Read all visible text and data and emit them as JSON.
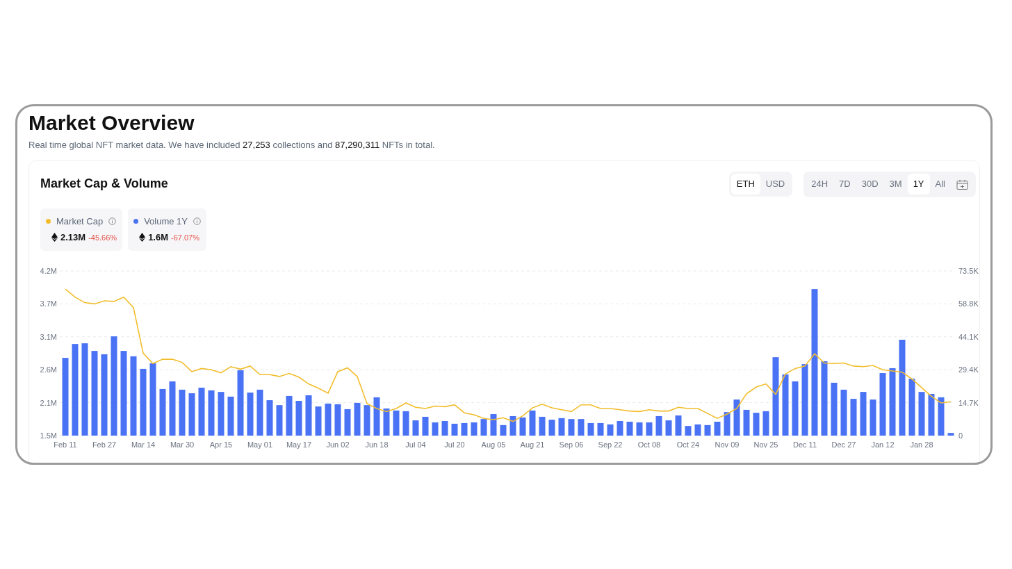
{
  "title": "Market Overview",
  "subtitle": [
    {
      "text": "Real time global NFT market data. We have included ",
      "highlight": false
    },
    {
      "text": "27,253",
      "highlight": true
    },
    {
      "text": " collections and ",
      "highlight": false
    },
    {
      "text": "87,290,311",
      "highlight": true
    },
    {
      "text": " NFTs in total.",
      "highlight": false
    }
  ],
  "card": {
    "title": "Market Cap & Volume",
    "currency_toggle": [
      {
        "label": "ETH",
        "selected": true
      },
      {
        "label": "USD",
        "selected": false
      }
    ],
    "range_toggle": [
      {
        "label": "24H",
        "selected": false
      },
      {
        "label": "7D",
        "selected": false
      },
      {
        "label": "30D",
        "selected": false
      },
      {
        "label": "3M",
        "selected": false
      },
      {
        "label": "1Y",
        "selected": true
      },
      {
        "label": "All",
        "selected": false
      }
    ],
    "legend": [
      {
        "value": "2.13M",
        "change": "-45.66%"
      },
      {
        "value": "1.6M",
        "change": "-67.07%"
      }
    ],
    "chart_data": {
      "type": "bar",
      "categories": [
        "Feb 11",
        null,
        null,
        null,
        "Feb 27",
        null,
        null,
        null,
        "Mar 14",
        null,
        null,
        null,
        "Mar 30",
        null,
        null,
        null,
        "Apr 15",
        null,
        null,
        null,
        "May 01",
        null,
        null,
        null,
        "May 17",
        null,
        null,
        null,
        "Jun 02",
        null,
        null,
        null,
        "Jun 18",
        null,
        null,
        null,
        "Jul 04",
        null,
        null,
        null,
        "Jul 20",
        null,
        null,
        null,
        "Aug 05",
        null,
        null,
        null,
        "Aug 21",
        null,
        null,
        null,
        "Sep 06",
        null,
        null,
        null,
        "Sep 22",
        null,
        null,
        null,
        "Oct 08",
        null,
        null,
        null,
        "Oct 24",
        null,
        null,
        null,
        "Nov 09",
        null,
        null,
        null,
        "Nov 25",
        null,
        null,
        null,
        "Dec 11",
        null,
        null,
        null,
        "Dec 27",
        null,
        null,
        null,
        "Jan 12",
        null,
        null,
        null,
        "Jan 28",
        null,
        null,
        null
      ],
      "grid": true,
      "ylim": [
        1.54,
        4.215
      ],
      "yticks": [
        {
          "value": 1.54,
          "label": "1.5M"
        },
        {
          "value": 2.075,
          "label": "2.1M"
        },
        {
          "value": 2.61,
          "label": "2.6M"
        },
        {
          "value": 3.145,
          "label": "3.1M"
        },
        {
          "value": 3.68,
          "label": "3.7M"
        },
        {
          "value": 4.215,
          "label": "4.2M"
        }
      ],
      "y2lim": [
        0,
        73.5
      ],
      "y2ticks": [
        {
          "value": 0,
          "label": "0"
        },
        {
          "value": 14.7,
          "label": "14.7K"
        },
        {
          "value": 29.4,
          "label": "29.4K"
        },
        {
          "value": 44.1,
          "label": "44.1K"
        },
        {
          "value": 58.8,
          "label": "58.8K"
        },
        {
          "value": 73.5,
          "label": "73.5K"
        }
      ],
      "series": [
        {
          "name": "Market Cap",
          "type": "line",
          "color": "#f2bd2c",
          "values": [
            3.92,
            3.79,
            3.7,
            3.68,
            3.73,
            3.72,
            3.79,
            3.62,
            2.88,
            2.71,
            2.78,
            2.78,
            2.73,
            2.58,
            2.63,
            2.61,
            2.56,
            2.66,
            2.62,
            2.67,
            2.53,
            2.53,
            2.5,
            2.55,
            2.49,
            2.38,
            2.31,
            2.23,
            2.58,
            2.64,
            2.5,
            2.06,
            1.98,
            1.93,
            1.98,
            2.07,
            2.0,
            1.98,
            2.02,
            2.01,
            2.04,
            1.91,
            1.88,
            1.82,
            1.8,
            1.83,
            1.77,
            1.86,
            1.99,
            2.05,
            1.99,
            1.96,
            1.93,
            2.04,
            2.04,
            1.98,
            1.98,
            1.96,
            1.94,
            1.93,
            1.96,
            1.94,
            1.94,
            2.0,
            1.98,
            1.98,
            1.9,
            1.82,
            1.89,
            1.98,
            2.22,
            2.33,
            2.38,
            2.21,
            2.54,
            2.63,
            2.67,
            2.87,
            2.72,
            2.71,
            2.72,
            2.67,
            2.66,
            2.68,
            2.61,
            2.59,
            2.57,
            2.46,
            2.32,
            2.18,
            2.07,
            2.09
          ]
        },
        {
          "name": "Volume 1Y",
          "type": "bar",
          "axis": "y2",
          "color": "#4a72f5",
          "values": [
            34.7,
            40.9,
            41.2,
            37.8,
            36.3,
            44.3,
            37.8,
            35.4,
            29.8,
            32.3,
            20.8,
            24.2,
            20.5,
            18.9,
            21.4,
            20.2,
            19.5,
            17.4,
            29.2,
            19.2,
            20.5,
            15.8,
            13.6,
            17.7,
            15.5,
            18.0,
            13.0,
            14.3,
            14.0,
            11.8,
            14.6,
            13.6,
            17.1,
            12.1,
            11.2,
            10.9,
            6.8,
            8.4,
            5.9,
            6.5,
            5.3,
            5.6,
            5.9,
            7.4,
            9.6,
            4.7,
            8.7,
            8.1,
            11.2,
            8.4,
            7.1,
            7.8,
            7.4,
            7.4,
            5.6,
            5.6,
            5.0,
            6.5,
            6.2,
            5.9,
            5.9,
            8.7,
            6.8,
            9.0,
            4.3,
            5.0,
            4.7,
            6.2,
            10.5,
            16.1,
            11.5,
            10.2,
            10.9,
            35.0,
            27.3,
            24.2,
            31.9,
            65.4,
            33.2,
            23.6,
            20.5,
            16.4,
            19.5,
            16.1,
            27.9,
            30.1,
            42.8,
            25.4,
            19.5,
            18.6,
            17.1,
            1.2
          ]
        }
      ]
    }
  }
}
